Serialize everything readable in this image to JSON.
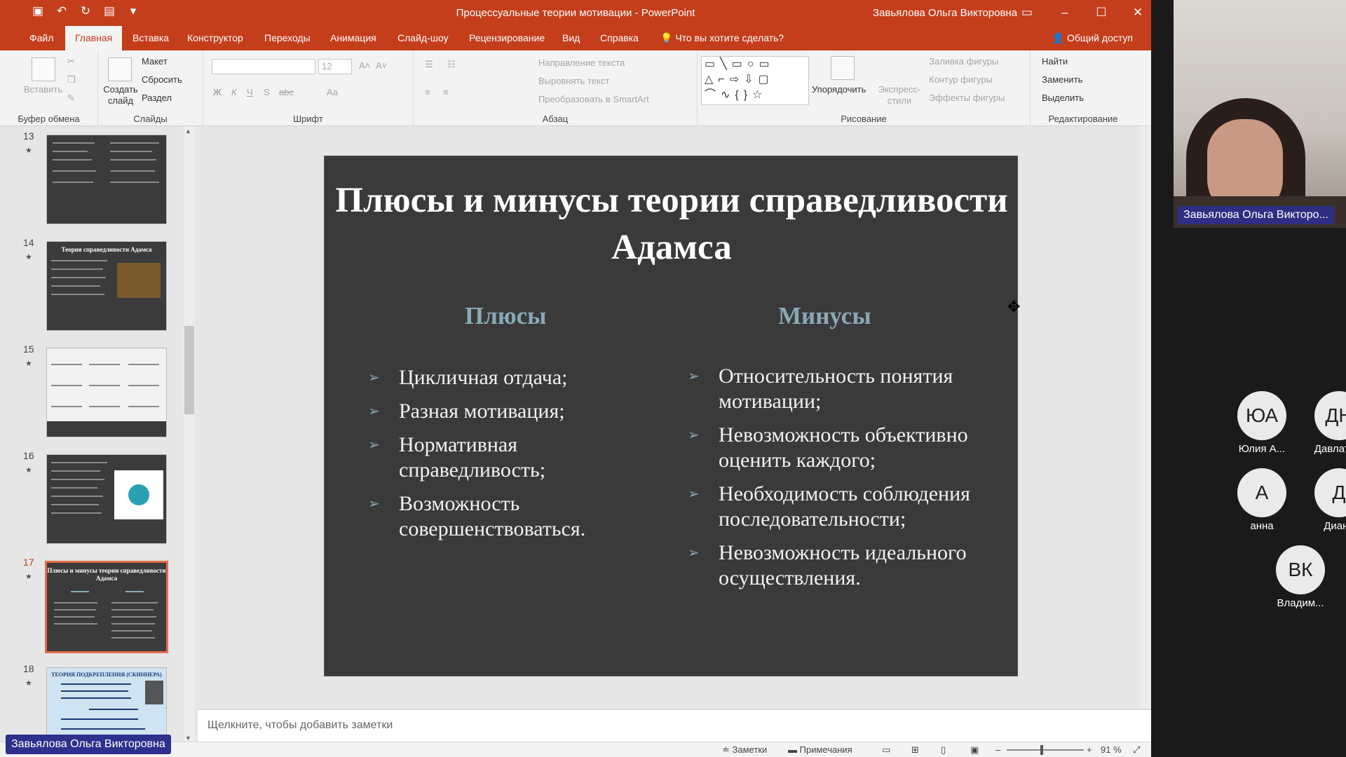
{
  "window": {
    "title": "Процессуальные теории мотивации  -  PowerPoint",
    "user": "Завьялова Ольга Викторовна",
    "qat_icons": [
      "save-icon",
      "undo-icon",
      "redo-icon",
      "start-presentation-icon",
      "customize-icon"
    ]
  },
  "menu": {
    "tabs": [
      "Файл",
      "Главная",
      "Вставка",
      "Конструктор",
      "Переходы",
      "Анимация",
      "Слайд-шоу",
      "Рецензирование",
      "Вид",
      "Справка"
    ],
    "active": "Главная",
    "tell_me": "Что вы хотите сделать?",
    "share": "Общий доступ"
  },
  "ribbon": {
    "clipboard": {
      "label": "Буфер обмена",
      "paste": "Вставить"
    },
    "slides": {
      "label": "Слайды",
      "new_slide": "Создать слайд",
      "layout": "Макет",
      "reset": "Сбросить",
      "section": "Раздел"
    },
    "font": {
      "label": "Шрифт",
      "size": "12",
      "bold": "Ж",
      "italic": "К",
      "underline": "Ч",
      "shadow": "S",
      "strike": "abc",
      "case": "Aa"
    },
    "paragraph": {
      "label": "Абзац",
      "text_direction": "Направление текста",
      "align_text": "Выровнять текст",
      "smartart": "Преобразовать в SmartArt"
    },
    "drawing": {
      "label": "Рисование",
      "shapes": "▭╲▭○▭ △⌐⇨⇩▢ ⌒∿{}☆",
      "arrange": "Упорядочить",
      "quick_styles": "Экспресс-стили",
      "fill": "Заливка фигуры",
      "outline": "Контур фигуры",
      "effects": "Эффекты фигуры"
    },
    "editing": {
      "label": "Редактирование",
      "find": "Найти",
      "replace": "Заменить",
      "select": "Выделить"
    }
  },
  "thumbnails": [
    {
      "num": "13",
      "title": ""
    },
    {
      "num": "14",
      "title": "Теория справедливости Адамса"
    },
    {
      "num": "15",
      "title": ""
    },
    {
      "num": "16",
      "title": ""
    },
    {
      "num": "17",
      "title": "Плюсы и минусы теории справедливости Адамса",
      "selected": true
    },
    {
      "num": "18",
      "title": "ТЕОРИЯ ПОДКРЕПЛЕНИЯ (СКИННЕРА)"
    }
  ],
  "slide": {
    "title": "Плюсы и минусы теории справедливости Адамса",
    "pros_heading": "Плюсы",
    "cons_heading": "Минусы",
    "pros": [
      "Цикличная отдача;",
      "Разная мотивация;",
      "Нормативная справедливость;",
      "Возможность совершенствоваться."
    ],
    "cons": [
      "Относительность понятия мотивации;",
      "Невозможность объективно оценить каждого;",
      "Необходимость соблюдения последовательности;",
      "Невозможность идеального осуществления."
    ],
    "colors": {
      "background": "#3a3a3a",
      "heading": "#8aa9b7",
      "text": "#f2f2f2"
    }
  },
  "notes_placeholder": "Щелкните, чтобы добавить заметки",
  "status": {
    "notes": "Заметки",
    "comments": "Примечания",
    "zoom": "91 %"
  },
  "meeting": {
    "self_name": "Завьялова Ольга Викторо...",
    "bottom_name": "Завьялова Ольга Викторовна",
    "participants": [
      {
        "initials": "ЮА",
        "name": "Юлия А..."
      },
      {
        "initials": "ДН",
        "name": "Давлатё..."
      },
      {
        "initials": "А",
        "name": "анна"
      },
      {
        "initials": "Д",
        "name": "Диана"
      },
      {
        "initials": "ВК",
        "name": "Владим..."
      }
    ]
  }
}
